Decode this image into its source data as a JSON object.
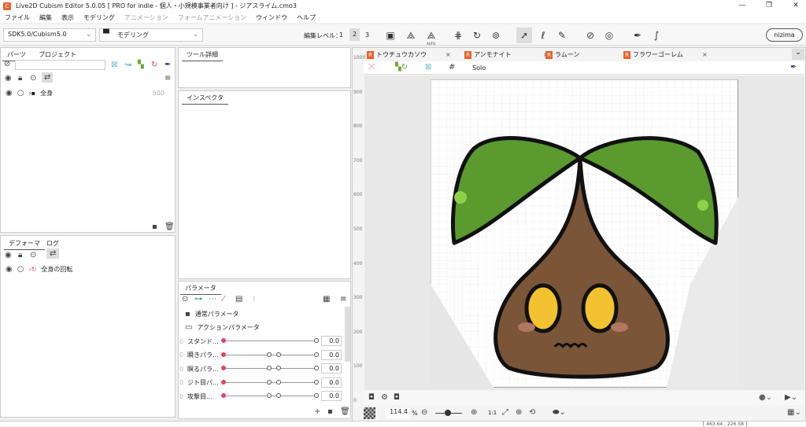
{
  "window": {
    "title": "Live2D Cubism Editor 5.0.05   [ PRO for indie - 個人・小規模事業者向け ]  - ジアスライム.cmo3",
    "min": "—",
    "max": "❐",
    "close": "✕"
  },
  "menu": [
    "ファイル",
    "編集",
    "表示",
    "モデリング",
    "アニメーション",
    "フォームアニメーション",
    "ウィンドウ",
    "ヘルプ"
  ],
  "toolbar": {
    "sdk": "SDK5.0/Cubism5.0",
    "mode": "モデリング",
    "edit_level_label": "編集レベル：",
    "levels": [
      "1",
      "2",
      "3"
    ],
    "active_level": "2",
    "nizima": "nizima",
    "auto": "AUTO"
  },
  "parts_panel": {
    "tabs": [
      "パーツ",
      "プロジェクト"
    ],
    "search_placeholder": "",
    "items": [
      {
        "label": "全身",
        "value": "500"
      }
    ]
  },
  "deformer_panel": {
    "tabs": [
      "デフォーマ",
      "ログ"
    ],
    "items": [
      {
        "label": "全身の回転"
      }
    ]
  },
  "tool_detail": {
    "title": "ツール詳細"
  },
  "inspector": {
    "title": "インスペクタ"
  },
  "parameters": {
    "title": "パラメータ",
    "groups": [
      "通常パラメータ",
      "アクションパラメータ"
    ],
    "items": [
      {
        "label": "スタンド...",
        "value": "0.0",
        "keys": 2
      },
      {
        "label": "瞬きパラ...",
        "value": "0.0",
        "keys": 4
      },
      {
        "label": "瞑るパラ...",
        "value": "0.0",
        "keys": 4
      },
      {
        "label": "ジト目パ...",
        "value": "0.0",
        "keys": 4
      },
      {
        "label": "攻撃目...",
        "value": "0.0",
        "keys": 4
      }
    ]
  },
  "canvas": {
    "tabs": [
      "トウチュウカソウ",
      "アンモナイト",
      "ラムーン",
      "フラワーゴーレム"
    ],
    "solo": "Solo",
    "ruler": [
      "1000",
      "900",
      "800",
      "700",
      "600",
      "500",
      "400",
      "300",
      "200",
      "100",
      "0"
    ],
    "zoom": "114.4",
    "zoom_unit": "%",
    "one_to_one": "1:1"
  },
  "status": {
    "coords": "[ 463.64 , 226.58 ]"
  },
  "colors": {
    "accent": "#e8622a",
    "param_red": "#e0435e",
    "leaf": "#5a9a2e",
    "body": "#7a5538",
    "eye": "#f2c230"
  }
}
